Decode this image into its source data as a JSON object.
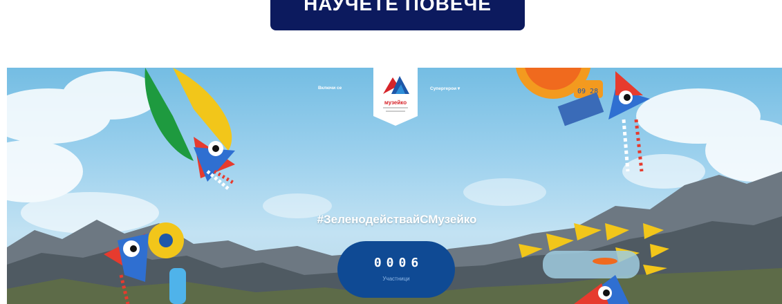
{
  "cta": {
    "label": "НАУЧЕТЕ ПОВЕЧЕ"
  },
  "nav": {
    "left_link": "Включи се",
    "right_link": "Супергерои ▾",
    "logo_text": "музейко"
  },
  "hero": {
    "hashtag": "#ЗеленодействайСМузейко",
    "counter_value": "0006",
    "counter_label": "Участници"
  },
  "illustrations": {
    "clock_text": "09 28"
  }
}
